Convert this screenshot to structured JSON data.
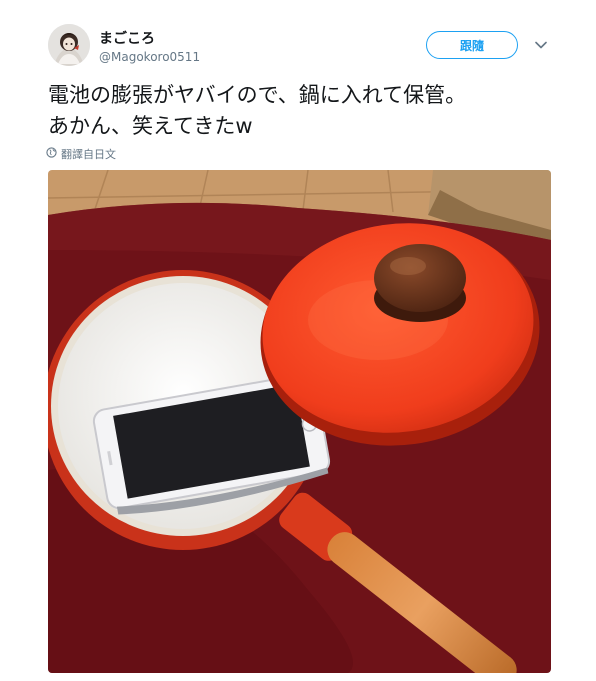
{
  "user": {
    "display_name": "まごころ",
    "handle": "@Magokoro0511"
  },
  "follow_button": {
    "label": "跟隨"
  },
  "tweet": {
    "lines": [
      "電池の膨張がヤバイので、鍋に入れて保管。",
      "あかん、笑えてきたw"
    ]
  },
  "translate": {
    "label": "翻譯自日文"
  },
  "icons": {
    "caret": "chevron-down-icon",
    "translate": "globe-icon"
  },
  "colors": {
    "accent": "#1da1f2",
    "secondary_text": "#657786"
  }
}
